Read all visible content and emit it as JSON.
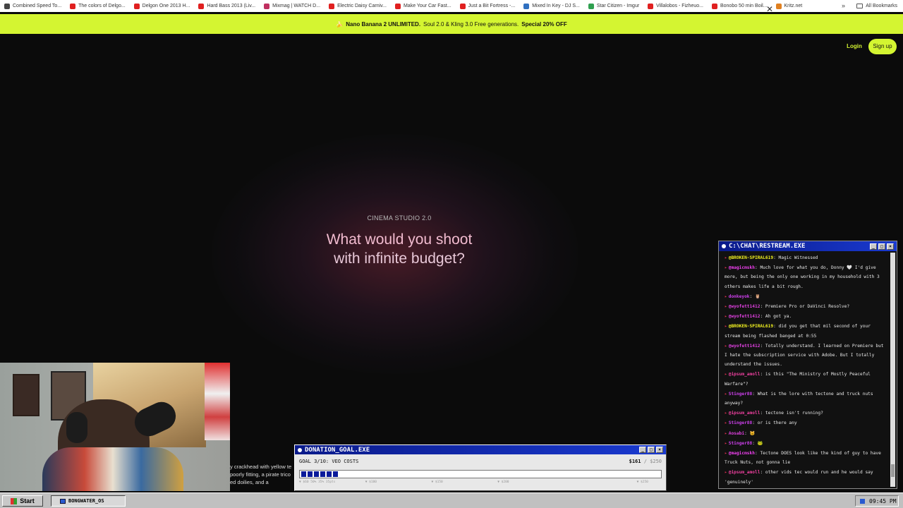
{
  "bookmarks": {
    "items": [
      {
        "label": "Combined Speed To...",
        "color": "#444444"
      },
      {
        "label": "The colors of Delgo...",
        "color": "#e02020"
      },
      {
        "label": "Delgon One 2013 H...",
        "color": "#e02020"
      },
      {
        "label": "Hard Bass 2013 (Liv...",
        "color": "#e02020"
      },
      {
        "label": "Mixmag | WATCH D...",
        "color": "#c03060"
      },
      {
        "label": "Electric Daisy Carniv...",
        "color": "#e02020"
      },
      {
        "label": "Make Your Car Fast...",
        "color": "#e02020"
      },
      {
        "label": "Just a Bit Fortress -...",
        "color": "#e02020"
      },
      {
        "label": "Mixed In Key - DJ S...",
        "color": "#3070c0"
      },
      {
        "label": "Star Citizen - Imgur",
        "color": "#30a050"
      },
      {
        "label": "Villalobos - Fizheuo...",
        "color": "#e02020"
      },
      {
        "label": "Bonobo 50 min Boil...",
        "color": "#e02020"
      },
      {
        "label": "Kritz.net",
        "color": "#e08020"
      }
    ],
    "overflow": "»",
    "all_bookmarks": "All Bookmarks"
  },
  "promo": {
    "icon": "🍌",
    "highlight": "Nano Banana 2 UNLIMITED.",
    "text": "Soul 2.0 & Kling 3.0 Free generations.",
    "offer": "Special 20% OFF",
    "close": "✕"
  },
  "nav": {
    "login": "Login",
    "signup": "Sign up"
  },
  "hero": {
    "kicker": "CINEMA STUDIO 2.0",
    "title_line1": "What would you shoot",
    "title_line2": "with infinite budget?"
  },
  "ticker": {
    "lines": [
      "y crackhead with yellow te",
      "poorly fitting, a pirate trico",
      "ed doilies, and a"
    ]
  },
  "chat_window": {
    "title": "C:\\CHAT\\RESTREAM.EXE",
    "messages": [
      {
        "user": "@BROKEN-SPIRAL619",
        "text": "Magic Witnessed",
        "color": "#f0f020"
      },
      {
        "user": "@magicmskh",
        "text": "Much love for what you do, Donny 🤍 I'd give more, but being the only one working in my household with 3 others makes life a bit rough.",
        "color": "#f040f0"
      },
      {
        "user": "donkeyok",
        "text": "🦉",
        "color": "#d040f0"
      },
      {
        "user": "@wyofett1412",
        "text": "Premiere Pro or DaVinci Resolve?",
        "color": "#e040e0"
      },
      {
        "user": "@wyofett1412",
        "text": "Ah got ya.",
        "color": "#e040e0"
      },
      {
        "user": "@BROKEN-SPIRAL619",
        "text": "did you get that mil second of your stream being flashed banged at 0:55",
        "color": "#f0f020"
      },
      {
        "user": "@wyofett1412",
        "text": "Totally understand. I learned on Premiere but I hate the subscription service with Adobe. But I totally understand the issues.",
        "color": "#e040e0"
      },
      {
        "user": "@ipsum_amoll",
        "text": "is this \"The Ministry of Mostly Peaceful Warfare\"?",
        "color": "#f040a0"
      },
      {
        "user": "Stinger88",
        "text": "What is the lore with tectone and truck nuts anyway?",
        "color": "#d040f0"
      },
      {
        "user": "@ipsum_amoll",
        "text": "tectone isn't running?",
        "color": "#f040a0"
      },
      {
        "user": "Stinger88",
        "text": "or is there any",
        "color": "#d040f0"
      },
      {
        "user": "Aosabi",
        "text": "🐱",
        "color": "#e040e0"
      },
      {
        "user": "Stinger88",
        "text": "🐸",
        "color": "#d040f0"
      },
      {
        "user": "@magicmskh",
        "text": "Tectone DOES look like the kind of guy to have Truck Nuts, not gonna lie",
        "color": "#f040f0"
      },
      {
        "user": "@ipsum_amoll",
        "text": "other vids tec would run and he would say 'genuinely'",
        "color": "#f040a0"
      }
    ],
    "btn_min": "_",
    "btn_max": "□",
    "btn_close": "×"
  },
  "donation": {
    "title": "DONATION_GOAL.EXE",
    "goal_label": "GOAL 3/10: VEO COSTS",
    "current": "$161",
    "separator": " / ",
    "target": "$250",
    "progress_fraction": 0.11,
    "milestones": [
      {
        "label": "▼ $60 50% 35% 35pts",
        "pos": 0.0
      },
      {
        "label": "▼ $100",
        "pos": 0.19
      },
      {
        "label": "▼ $150",
        "pos": 0.38
      },
      {
        "label": "▼ $200",
        "pos": 0.57
      },
      {
        "label": "▼ $250",
        "pos": 0.97
      }
    ],
    "btn_min": "_",
    "btn_max": "□",
    "btn_close": "×"
  },
  "taskbar": {
    "start": "Start",
    "task_label": "BONGWATER_OS",
    "clock": "09:45 PM"
  }
}
